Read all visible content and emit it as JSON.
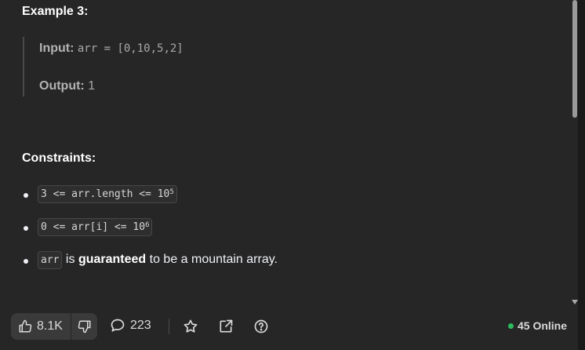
{
  "example": {
    "title": "Example 3:",
    "input_label": "Input:",
    "input_value": "arr = [0,10,5,2]",
    "output_label": "Output:",
    "output_value": "1"
  },
  "constraints": {
    "title": "Constraints:",
    "items": [
      {
        "code_base": "3 <= arr.length <= 10",
        "code_sup": "5"
      },
      {
        "code_base": "0 <= arr[i] <= 10",
        "code_sup": "6"
      },
      {
        "code": "arr",
        "text_pre": " is ",
        "text_bold": "guaranteed",
        "text_post": " to be a mountain array."
      }
    ]
  },
  "bottom_bar": {
    "likes": "8.1K",
    "comments": "223",
    "online_count": "45 Online",
    "online_color": "#2cbb5d",
    "icons": [
      "thumbs-up-icon",
      "thumbs-down-icon",
      "comment-icon",
      "star-icon",
      "share-icon",
      "help-icon"
    ]
  }
}
